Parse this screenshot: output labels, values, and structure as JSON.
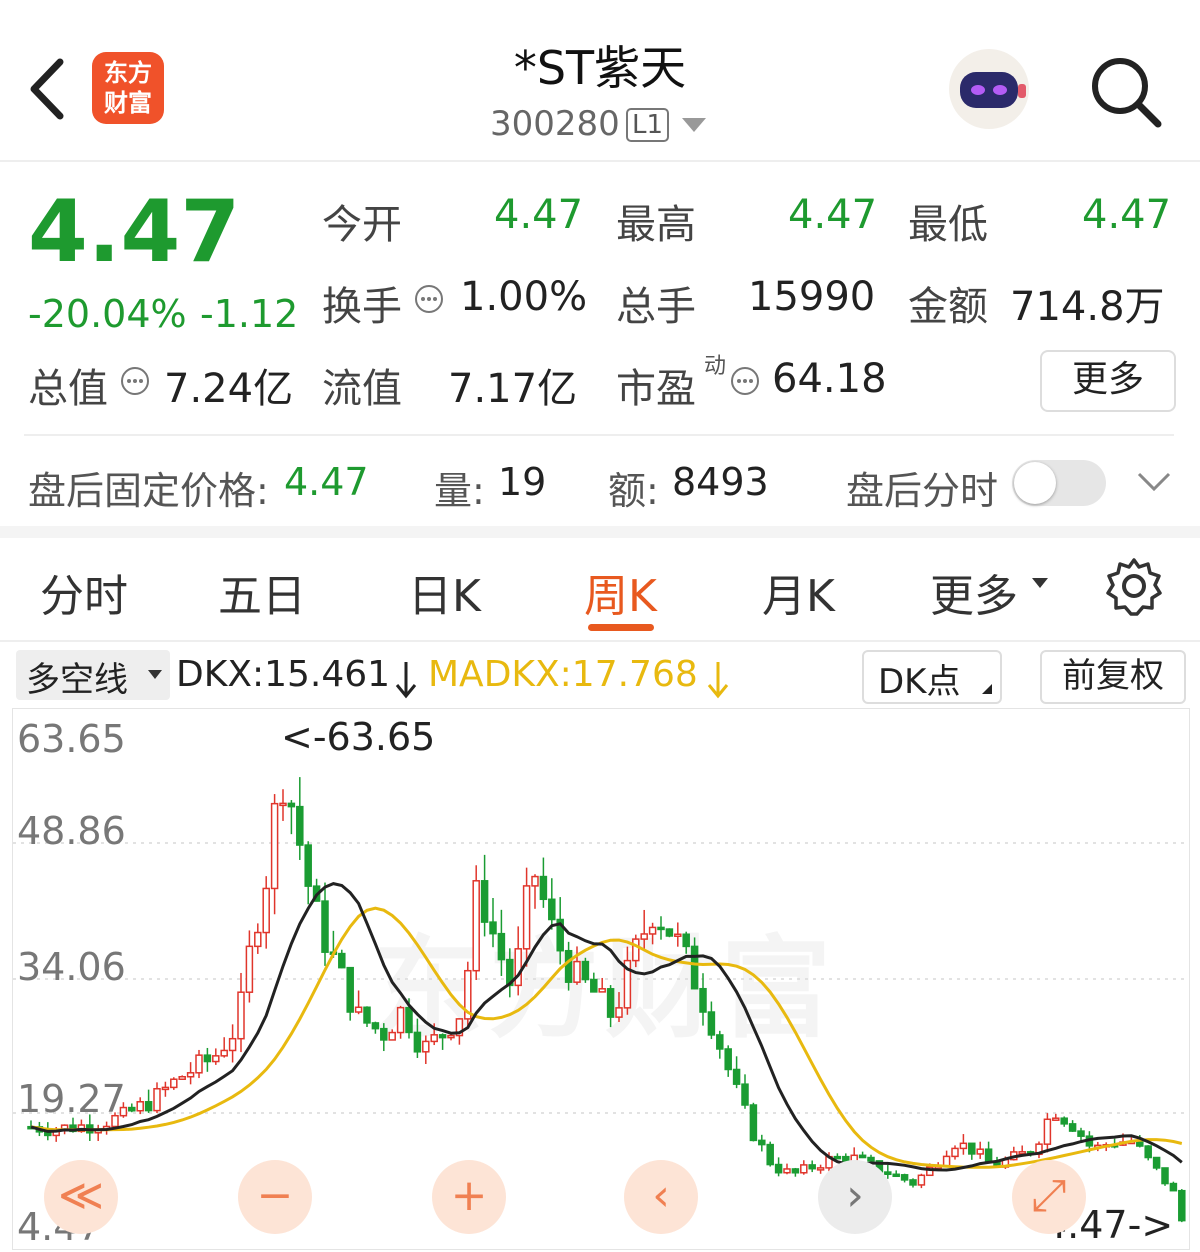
{
  "header": {
    "title": "*ST紫天",
    "code": "300280",
    "level": "L1",
    "logo_line1": "东方",
    "logo_line2": "财富"
  },
  "quote": {
    "price": "4.47",
    "change_pct": "-20.04%",
    "change": "-1.12",
    "fields": [
      {
        "label": "今开",
        "value": "4.47"
      },
      {
        "label": "最高",
        "value": "4.47"
      },
      {
        "label": "最低",
        "value": "4.47"
      },
      {
        "label": "换手",
        "value": "1.00%"
      },
      {
        "label": "总手",
        "value": "15990"
      },
      {
        "label": "金额",
        "value": "714.8万"
      },
      {
        "label": "总值",
        "value": "7.24亿"
      },
      {
        "label": "流值",
        "value": "7.17亿"
      },
      {
        "label": "市盈",
        "sup": "动",
        "value": "64.18"
      }
    ],
    "more_button": "更多"
  },
  "after_hours": {
    "fixed_label": "盘后固定价格:",
    "fixed_value": "4.47",
    "vol_label": "量:",
    "vol_value": "19",
    "amt_label": "额:",
    "amt_value": "8493",
    "toggle_label": "盘后分时",
    "toggle_on": false
  },
  "tabs": [
    "分时",
    "五日",
    "日K",
    "周K",
    "月K",
    "更多"
  ],
  "active_tab": "周K",
  "indicator": {
    "selector": "多空线",
    "dkx": "DKX:15.461",
    "madkx": "MADKX:17.768",
    "dk_button": "DK点",
    "adjust_button": "前复权"
  },
  "chart_data": {
    "type": "candlestick",
    "y_ticks": [
      "63.65",
      "48.86",
      "34.06",
      "19.27",
      "4.47"
    ],
    "max_annotation": "<-63.65",
    "last_annotation": "4.47->",
    "ylim": [
      4.47,
      63.65
    ],
    "watermark": "东方财富",
    "colors": {
      "up": "#e0352b",
      "down": "#1a9c32",
      "dkx": "#222222",
      "madkx": "#e8b90f"
    }
  },
  "controls": [
    "≪",
    "−",
    "+",
    "‹",
    "›",
    "⤢"
  ]
}
